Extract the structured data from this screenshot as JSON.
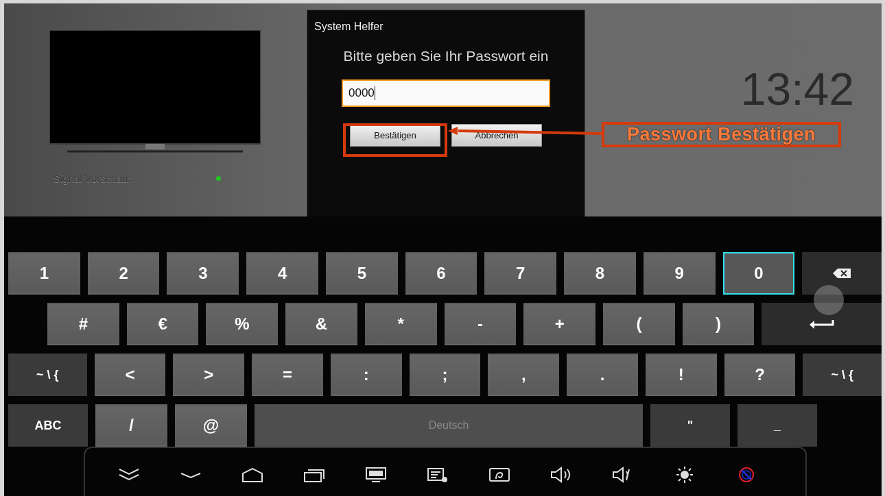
{
  "preview": {
    "label": "Signal Vorschau:"
  },
  "dialog": {
    "title": "System Helfer",
    "prompt": "Bitte geben Sie Ihr Passwort ein",
    "password_field": {
      "value": "0000"
    },
    "buttons": [
      {
        "label": "Bestätigen"
      },
      {
        "label": "Abbrechen"
      }
    ]
  },
  "clock": "13:42",
  "annotation": {
    "text": "Passwort Bestätigen"
  },
  "keyboard": {
    "rows": [
      {
        "keys": [
          {
            "kind": "char",
            "label": "1",
            "selected": false
          },
          {
            "kind": "char",
            "label": "2",
            "selected": false
          },
          {
            "kind": "char",
            "label": "3",
            "selected": false
          },
          {
            "kind": "char",
            "label": "4",
            "selected": false
          },
          {
            "kind": "char",
            "label": "5",
            "selected": false
          },
          {
            "kind": "char",
            "label": "6",
            "selected": false
          },
          {
            "kind": "char",
            "label": "7",
            "selected": false
          },
          {
            "kind": "char",
            "label": "8",
            "selected": false
          },
          {
            "kind": "char",
            "label": "9",
            "selected": false
          },
          {
            "kind": "char",
            "label": "0",
            "selected": true
          },
          {
            "kind": "backspace",
            "selected": false
          }
        ]
      },
      {
        "keys": [
          {
            "kind": "char",
            "label": "#",
            "selected": false
          },
          {
            "kind": "char",
            "label": "€",
            "selected": false
          },
          {
            "kind": "char",
            "label": "%",
            "selected": false
          },
          {
            "kind": "char",
            "label": "&",
            "selected": false
          },
          {
            "kind": "char",
            "label": "*",
            "selected": false
          },
          {
            "kind": "char",
            "label": "-",
            "selected": false
          },
          {
            "kind": "char",
            "label": "+",
            "selected": false
          },
          {
            "kind": "char",
            "label": "(",
            "selected": false
          },
          {
            "kind": "char",
            "label": ")",
            "selected": false
          },
          {
            "kind": "enter",
            "selected": false
          }
        ]
      },
      {
        "keys": [
          {
            "kind": "function",
            "label": "~ \\ {",
            "selected": false
          },
          {
            "kind": "char",
            "label": "<",
            "selected": false
          },
          {
            "kind": "char",
            "label": ">",
            "selected": false
          },
          {
            "kind": "char",
            "label": "=",
            "selected": false
          },
          {
            "kind": "char",
            "label": ":",
            "selected": false
          },
          {
            "kind": "char",
            "label": ";",
            "selected": false
          },
          {
            "kind": "char",
            "label": ",",
            "selected": false
          },
          {
            "kind": "char",
            "label": ".",
            "selected": false
          },
          {
            "kind": "char",
            "label": "!",
            "selected": false
          },
          {
            "kind": "char",
            "label": "?",
            "selected": false
          },
          {
            "kind": "function",
            "label": "~ \\ {",
            "selected": false
          }
        ]
      },
      {
        "keys": [
          {
            "kind": "function",
            "label": "ABC",
            "selected": false
          },
          {
            "kind": "char",
            "label": "/",
            "selected": false
          },
          {
            "kind": "char",
            "label": "@",
            "selected": false
          },
          {
            "kind": "space",
            "label": "Deutsch",
            "selected": false
          },
          {
            "kind": "function",
            "label": "\"",
            "selected": false
          },
          {
            "kind": "function",
            "label": "_",
            "selected": false
          }
        ]
      }
    ]
  }
}
